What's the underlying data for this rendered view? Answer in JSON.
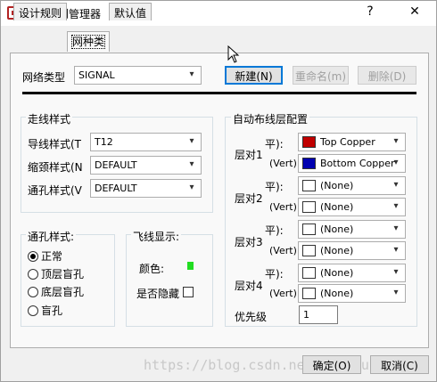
{
  "window": {
    "title": "设计规则管理器",
    "help_label": "?",
    "close_label": "✕"
  },
  "tabs": [
    {
      "label": "设计规则"
    },
    {
      "label": "网种类"
    },
    {
      "label": "默认值"
    }
  ],
  "net_class": {
    "label": "网络类型",
    "value": "SIGNAL",
    "new_button": "新建(N)",
    "rename_button": "重命名(m)",
    "delete_button": "删除(D)"
  },
  "trace_style": {
    "title": "走线样式",
    "rows": [
      {
        "label": "导线样式(T",
        "value": "T12"
      },
      {
        "label": "缩颈样式(N",
        "value": "DEFAULT"
      },
      {
        "label": "通孔样式(V",
        "value": "DEFAULT"
      }
    ]
  },
  "via_style": {
    "title": "通孔样式:",
    "options": [
      {
        "label": "正常",
        "checked": true
      },
      {
        "label": "顶层盲孔",
        "checked": false
      },
      {
        "label": "底层盲孔",
        "checked": false
      },
      {
        "label": "盲孔",
        "checked": false
      }
    ]
  },
  "ratsnest": {
    "title": "飞线显示:",
    "color_label": "颜色:",
    "hide_label": "是否隐藏",
    "color": "#22dd22",
    "hidden": false
  },
  "autoroute": {
    "title": "自动布线层配置",
    "pairs": [
      {
        "name": "层对1",
        "horizontal_label": "平):",
        "vertical_label": "(Vert):",
        "horizontal_value": "Top Copper",
        "horizontal_color": "#c00000",
        "vertical_value": "Bottom Copper",
        "vertical_color": "#0000b0"
      },
      {
        "name": "层对2",
        "horizontal_label": "平):",
        "vertical_label": "(Vert):",
        "horizontal_value": "(None)",
        "horizontal_color": "#ffffff",
        "vertical_value": "(None)",
        "vertical_color": "#ffffff"
      },
      {
        "name": "层对3",
        "horizontal_label": "平):",
        "vertical_label": "(Vert):",
        "horizontal_value": "(None)",
        "horizontal_color": "#ffffff",
        "vertical_value": "(None)",
        "vertical_color": "#ffffff"
      },
      {
        "name": "层对4",
        "horizontal_label": "平):",
        "vertical_label": "(Vert):",
        "horizontal_value": "(None)",
        "horizontal_color": "#ffffff",
        "vertical_value": "(None)",
        "vertical_color": "#ffffff"
      }
    ],
    "priority_label": "优先级",
    "priority_value": "1"
  },
  "footer": {
    "ok_button": "确定(O)",
    "cancel_button": "取消(C)"
  },
  "watermark": "https://blog.csdn.net/Wangfun"
}
